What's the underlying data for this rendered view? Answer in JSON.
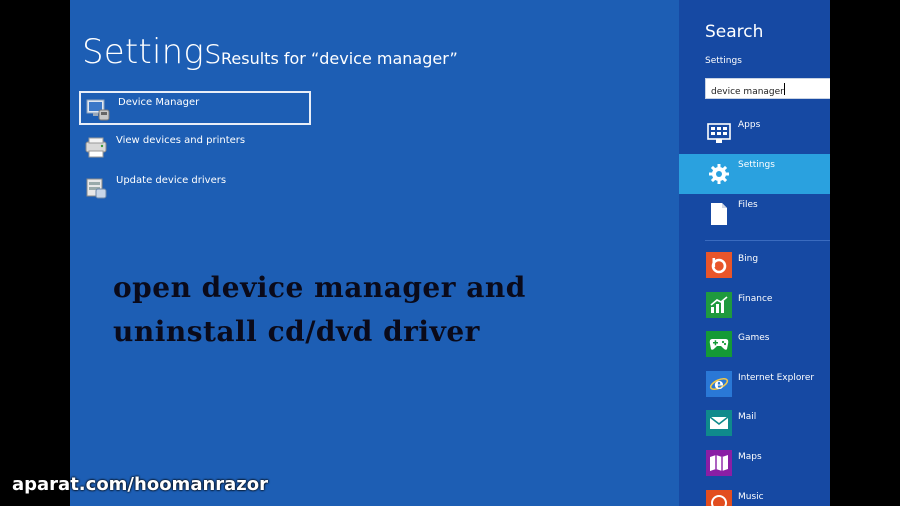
{
  "main": {
    "title": "Settings",
    "results_for": "Results for “device manager”",
    "results": [
      {
        "label": "Device Manager",
        "icon": "device-manager-icon"
      },
      {
        "label": "View devices and printers",
        "icon": "devices-printers-icon"
      },
      {
        "label": "Update device drivers",
        "icon": "update-drivers-icon"
      }
    ]
  },
  "overlay": {
    "line1": "open device manager and",
    "line2": "uninstall cd/dvd driver"
  },
  "charm": {
    "title": "Search",
    "scope": "Settings",
    "search_value": "device manager",
    "categories": [
      {
        "label": "Apps",
        "icon": "apps-icon"
      },
      {
        "label": "Settings",
        "icon": "gear-icon",
        "active": true
      },
      {
        "label": "Files",
        "icon": "file-icon"
      }
    ],
    "apps": [
      {
        "label": "Bing",
        "icon": "bing-icon",
        "color": "#e8552a"
      },
      {
        "label": "Finance",
        "icon": "finance-icon",
        "color": "#1f9a3e"
      },
      {
        "label": "Games",
        "icon": "games-icon",
        "color": "#149a36"
      },
      {
        "label": "Internet Explorer",
        "icon": "internet-explorer-icon",
        "color": "#2a78d6"
      },
      {
        "label": "Mail",
        "icon": "mail-icon",
        "color": "#0f8a8c"
      },
      {
        "label": "Maps",
        "icon": "maps-icon",
        "color": "#8a1ea5"
      },
      {
        "label": "Music",
        "icon": "music-icon",
        "color": "#e24d1f"
      }
    ]
  },
  "watermark": "aparat.com/hoomanrazor",
  "colors": {
    "screen_bg": "#1d5eb4",
    "charm_bg": "#1649a3",
    "active_category": "#2aa1df"
  }
}
